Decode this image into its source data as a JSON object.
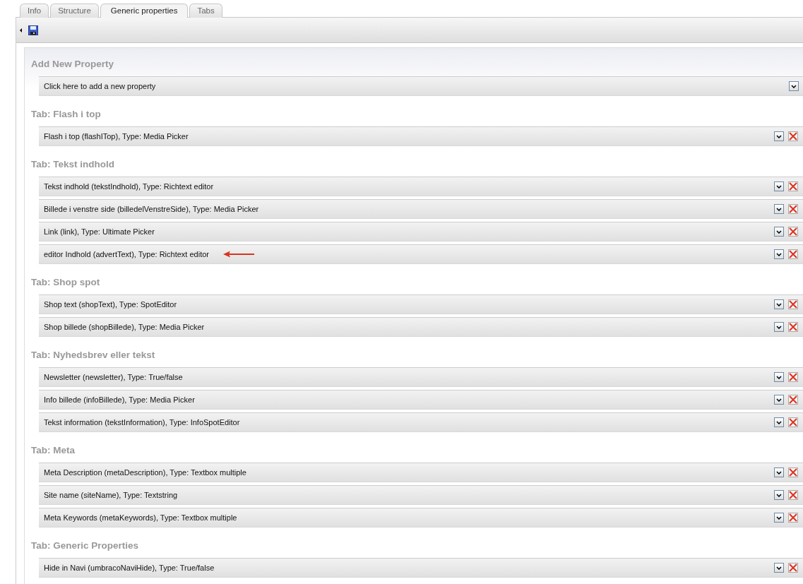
{
  "tabs": [
    {
      "label": "Info",
      "selected": false
    },
    {
      "label": "Structure",
      "selected": false
    },
    {
      "label": "Generic properties",
      "selected": true
    },
    {
      "label": "Tabs",
      "selected": false
    }
  ],
  "add_property": {
    "heading": "Add New Property",
    "row": "Click here to add a new property"
  },
  "sections": [
    {
      "heading": "Tab: Flash i top",
      "rows": [
        {
          "label": "Flash i top (flashITop), Type: Media Picker",
          "arrow": false
        }
      ]
    },
    {
      "heading": "Tab: Tekst indhold",
      "rows": [
        {
          "label": "Tekst indhold (tekstIndhold), Type: Richtext editor",
          "arrow": false
        },
        {
          "label": "Billede i venstre side (billedelVenstreSide), Type: Media Picker",
          "arrow": false
        },
        {
          "label": "Link (link), Type: Ultimate Picker",
          "arrow": false
        },
        {
          "label": "editor Indhold (advertText), Type: Richtext editor",
          "arrow": true
        }
      ]
    },
    {
      "heading": "Tab: Shop spot",
      "rows": [
        {
          "label": "Shop text (shopText), Type: SpotEditor",
          "arrow": false
        },
        {
          "label": "Shop billede (shopBillede), Type: Media Picker",
          "arrow": false
        }
      ]
    },
    {
      "heading": "Tab: Nyhedsbrev eller tekst",
      "rows": [
        {
          "label": "Newsletter (newsletter), Type: True/false",
          "arrow": false
        },
        {
          "label": "Info billede (infoBillede), Type: Media Picker",
          "arrow": false
        },
        {
          "label": "Tekst information (tekstInformation), Type: InfoSpotEditor",
          "arrow": false
        }
      ]
    },
    {
      "heading": "Tab: Meta",
      "rows": [
        {
          "label": "Meta Description (metaDescription), Type: Textbox multiple",
          "arrow": false
        },
        {
          "label": "Site name (siteName), Type: Textstring",
          "arrow": false
        },
        {
          "label": "Meta Keywords (metaKeywords), Type: Textbox multiple",
          "arrow": false
        }
      ]
    },
    {
      "heading": "Tab: Generic Properties",
      "rows": [
        {
          "label": "Hide in Navi (umbracoNaviHide), Type: True/false",
          "arrow": false
        }
      ]
    }
  ]
}
